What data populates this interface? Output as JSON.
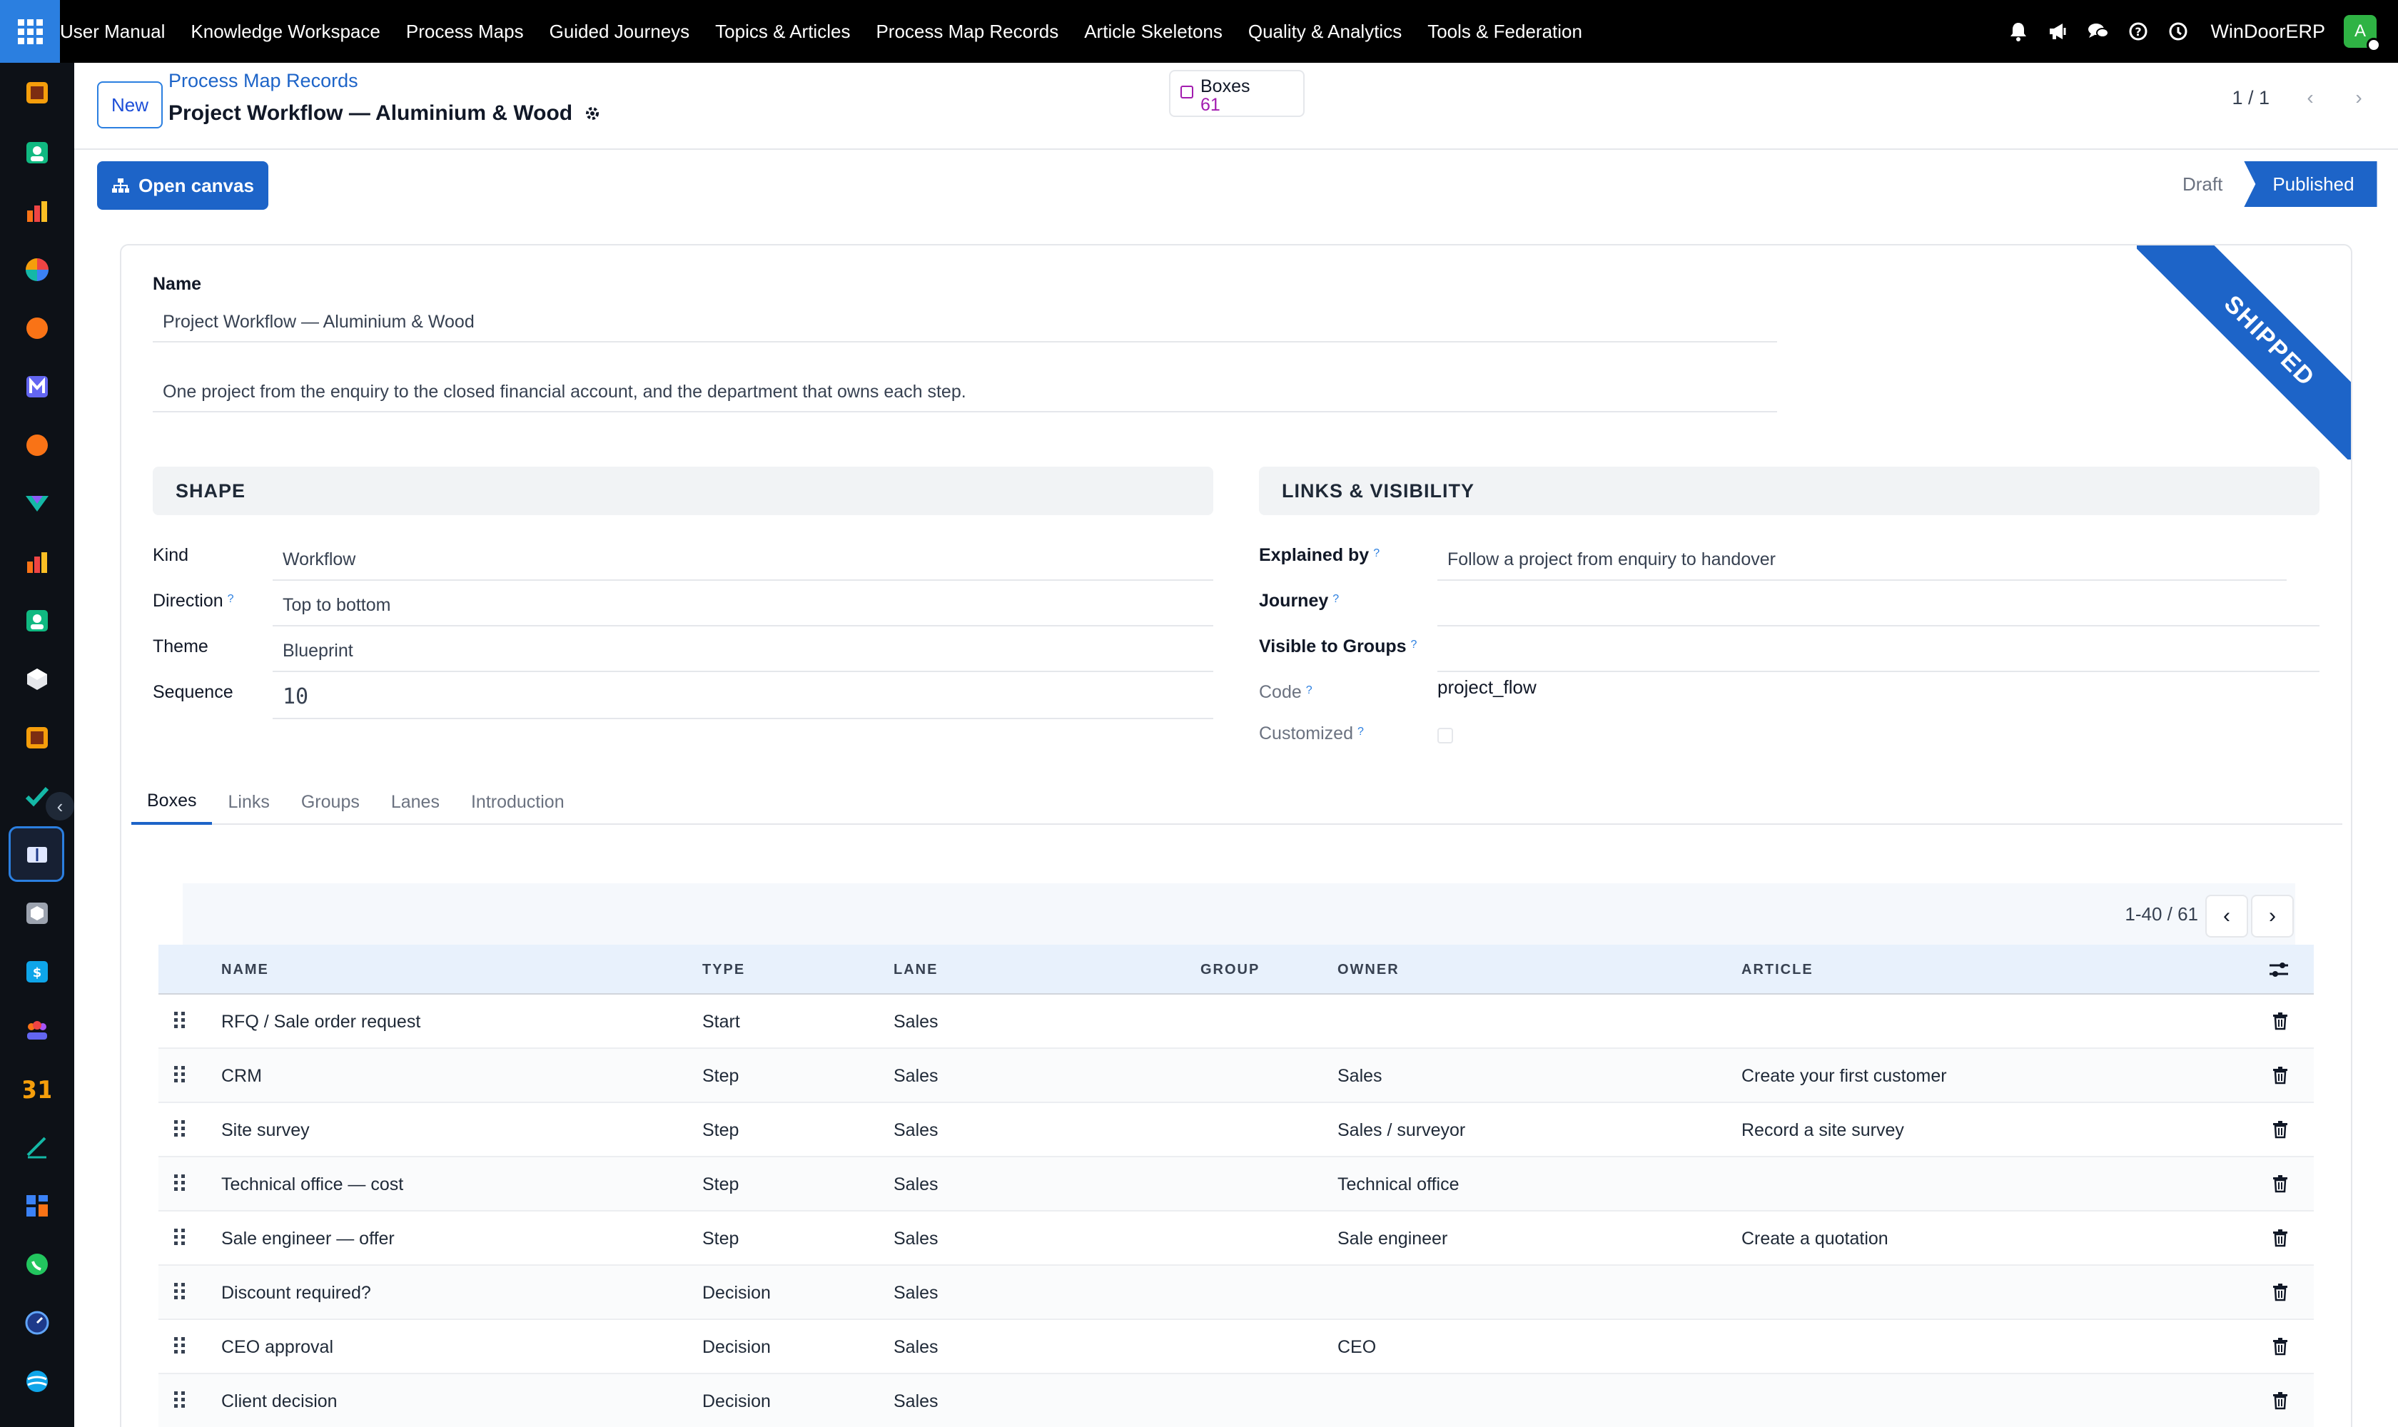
{
  "nav": {
    "menu": [
      "User Manual",
      "Knowledge Workspace",
      "Process Maps",
      "Guided Journeys",
      "Topics & Articles",
      "Process Map Records",
      "Article Skeletons",
      "Quality & Analytics",
      "Tools & Federation"
    ],
    "company": "WinDoorERP",
    "avatar_letter": "A"
  },
  "control": {
    "new_label": "New",
    "breadcrumb": "Process Map Records",
    "record_title": "Project Workflow — Aluminium & Wood",
    "smart_button": {
      "label": "Boxes",
      "count": "61"
    },
    "pager": "1 / 1"
  },
  "actions": {
    "open_canvas": "Open canvas",
    "statuses": [
      "Draft",
      "Published"
    ],
    "active_status": "Published"
  },
  "ribbon": "SHIPPED",
  "form": {
    "name_label": "Name",
    "name_value": "Project Workflow — Aluminium & Wood",
    "description": "One project from the enquiry to the closed financial account, and the department that owns each step.",
    "shape": {
      "title": "SHAPE",
      "kind_label": "Kind",
      "kind": "Workflow",
      "direction_label": "Direction",
      "direction": "Top to bottom",
      "theme_label": "Theme",
      "theme": "Blueprint",
      "sequence_label": "Sequence",
      "sequence": "10"
    },
    "links": {
      "title": "LINKS & VISIBILITY",
      "explained_label": "Explained by",
      "explained": "Follow a project from enquiry to handover",
      "journey_label": "Journey",
      "journey": "",
      "groups_label": "Visible to Groups",
      "groups": "",
      "code_label": "Code",
      "code": "project_flow",
      "customized_label": "Customized",
      "customized": false
    }
  },
  "tabs": [
    "Boxes",
    "Links",
    "Groups",
    "Lanes",
    "Introduction"
  ],
  "active_tab": "Boxes",
  "table": {
    "pager": "1-40 / 61",
    "headers": {
      "name": "NAME",
      "type": "TYPE",
      "lane": "LANE",
      "group": "GROUP",
      "owner": "OWNER",
      "article": "ARTICLE"
    },
    "rows": [
      {
        "name": "RFQ / Sale order request",
        "type": "Start",
        "lane": "Sales",
        "group": "",
        "owner": "",
        "article": ""
      },
      {
        "name": "CRM",
        "type": "Step",
        "lane": "Sales",
        "group": "",
        "owner": "Sales",
        "article": "Create your first customer"
      },
      {
        "name": "Site survey",
        "type": "Step",
        "lane": "Sales",
        "group": "",
        "owner": "Sales / surveyor",
        "article": "Record a site survey"
      },
      {
        "name": "Technical office — cost",
        "type": "Step",
        "lane": "Sales",
        "group": "",
        "owner": "Technical office",
        "article": ""
      },
      {
        "name": "Sale engineer — offer",
        "type": "Step",
        "lane": "Sales",
        "group": "",
        "owner": "Sale engineer",
        "article": "Create a quotation"
      },
      {
        "name": "Discount required?",
        "type": "Decision",
        "lane": "Sales",
        "group": "",
        "owner": "",
        "article": ""
      },
      {
        "name": "CEO approval",
        "type": "Decision",
        "lane": "Sales",
        "group": "",
        "owner": "CEO",
        "article": ""
      },
      {
        "name": "Client decision",
        "type": "Decision",
        "lane": "Sales",
        "group": "",
        "owner": "",
        "article": ""
      }
    ]
  },
  "colors": {
    "brand": "#1d64c8",
    "topbar": "#000000",
    "sidebar": "#0d1117",
    "smart_accent": "#a21caf"
  },
  "icons": {
    "topbar": [
      "bell-icon",
      "megaphone-icon",
      "chat-icon",
      "help-icon",
      "clock-icon"
    ],
    "sidebar": [
      "documents-app-icon",
      "contacts-app-icon",
      "sales-app-icon",
      "dashboard-app-icon",
      "discuss-app-icon",
      "email-marketing-app-icon",
      "livechat-app-icon",
      "project-app-icon",
      "reporting-app-icon",
      "employees-app-icon",
      "inventory-app-icon",
      "documents-app-icon",
      "todo-app-icon",
      "knowledge-app-icon",
      "products-app-icon",
      "invoicing-app-icon",
      "team-app-icon",
      "calendar-app-icon",
      "sign-app-icon",
      "apps-app-icon",
      "whatsapp-app-icon",
      "timer-app-icon",
      "website-app-icon"
    ]
  }
}
